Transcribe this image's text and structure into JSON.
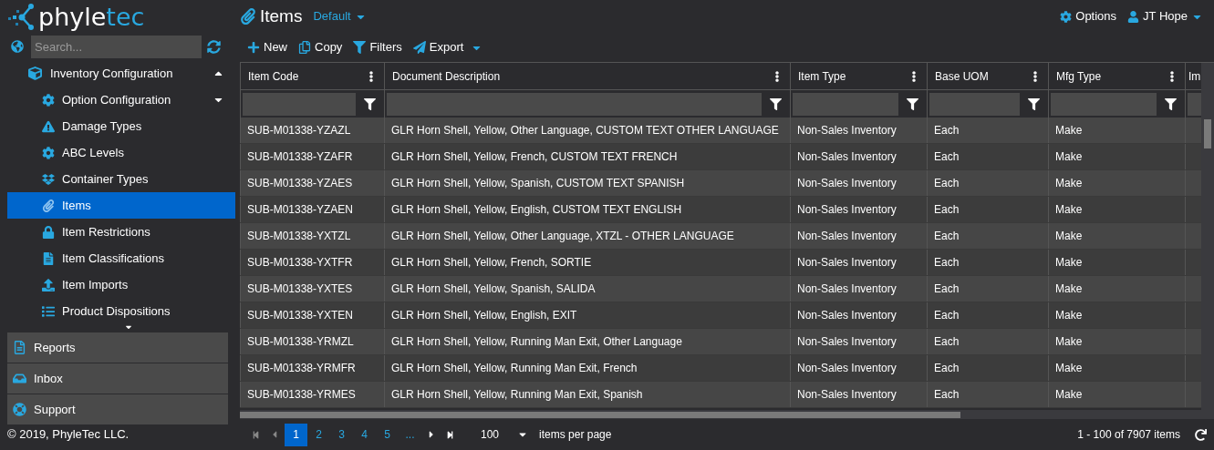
{
  "brand": {
    "name_left": "phyle",
    "name_right": "tec"
  },
  "search": {
    "placeholder": "Search..."
  },
  "nav": {
    "label": "Inventory Configuration",
    "expanded": true,
    "children": [
      {
        "label": "Option Configuration",
        "selected": false,
        "expanded": false
      },
      {
        "label": "Damage Types",
        "selected": false
      },
      {
        "label": "ABC Levels",
        "selected": false
      },
      {
        "label": "Container Types",
        "selected": false
      },
      {
        "label": "Items",
        "selected": true
      },
      {
        "label": "Item Restrictions",
        "selected": false
      },
      {
        "label": "Item Classifications",
        "selected": false
      },
      {
        "label": "Item Imports",
        "selected": false
      },
      {
        "label": "Product Dispositions",
        "selected": false
      }
    ]
  },
  "sections": [
    "Reports",
    "Inbox",
    "Support"
  ],
  "copyright": "© 2019, PhyleTec LLC.",
  "page": {
    "title": "Items",
    "view": "Default"
  },
  "top_links": {
    "options": "Options",
    "user": "JT Hope"
  },
  "toolbar": [
    "New",
    "Copy",
    "Filters",
    "Export"
  ],
  "table": {
    "columns": [
      "Item Code",
      "Document Description",
      "Item Type",
      "Base UOM",
      "Mfg Type",
      "Im"
    ],
    "rows": [
      [
        "SUB-M01338-YZAZL",
        "GLR Horn Shell, Yellow, Other Language, CUSTOM TEXT OTHER LANGUAGE",
        "Non-Sales Inventory",
        "Each",
        "Make"
      ],
      [
        "SUB-M01338-YZAFR",
        "GLR Horn Shell, Yellow, French, CUSTOM TEXT FRENCH",
        "Non-Sales Inventory",
        "Each",
        "Make"
      ],
      [
        "SUB-M01338-YZAES",
        "GLR Horn Shell, Yellow, Spanish, CUSTOM TEXT SPANISH",
        "Non-Sales Inventory",
        "Each",
        "Make"
      ],
      [
        "SUB-M01338-YZAEN",
        "GLR Horn Shell, Yellow, English, CUSTOM TEXT ENGLISH",
        "Non-Sales Inventory",
        "Each",
        "Make"
      ],
      [
        "SUB-M01338-YXTZL",
        "GLR Horn Shell, Yellow, Other Language, XTZL - OTHER LANGUAGE",
        "Non-Sales Inventory",
        "Each",
        "Make"
      ],
      [
        "SUB-M01338-YXTFR",
        "GLR Horn Shell, Yellow, French, SORTIE",
        "Non-Sales Inventory",
        "Each",
        "Make"
      ],
      [
        "SUB-M01338-YXTES",
        "GLR Horn Shell, Yellow, Spanish, SALIDA",
        "Non-Sales Inventory",
        "Each",
        "Make"
      ],
      [
        "SUB-M01338-YXTEN",
        "GLR Horn Shell, Yellow, English, EXIT",
        "Non-Sales Inventory",
        "Each",
        "Make"
      ],
      [
        "SUB-M01338-YRMZL",
        "GLR Horn Shell, Yellow, Running Man Exit, Other Language",
        "Non-Sales Inventory",
        "Each",
        "Make"
      ],
      [
        "SUB-M01338-YRMFR",
        "GLR Horn Shell, Yellow, Running Man Exit, French",
        "Non-Sales Inventory",
        "Each",
        "Make"
      ],
      [
        "SUB-M01338-YRMES",
        "GLR Horn Shell, Yellow, Running Man Exit, Spanish",
        "Non-Sales Inventory",
        "Each",
        "Make"
      ]
    ]
  },
  "pager": {
    "pages": [
      {
        "label": "1",
        "selected": true
      },
      {
        "label": "2",
        "selected": false
      },
      {
        "label": "3",
        "selected": false
      },
      {
        "label": "4",
        "selected": false
      },
      {
        "label": "5",
        "selected": false
      },
      {
        "label": "...",
        "selected": false
      }
    ],
    "page_size": "100",
    "per_page_label": "items per page",
    "summary": "1 - 100 of 7907 items"
  }
}
